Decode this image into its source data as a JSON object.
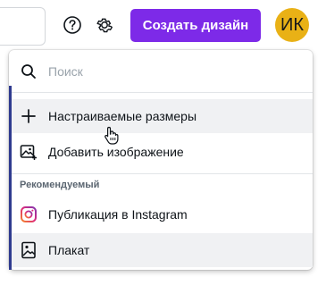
{
  "header": {
    "create_button_label": "Создать дизайн",
    "avatar_initials": "ИК",
    "help_icon": "question-circle-icon",
    "settings_icon": "gear-icon"
  },
  "dropdown": {
    "search_placeholder": "Поиск",
    "items": [
      {
        "label": "Настраиваемые размеры",
        "icon": "plus-icon"
      },
      {
        "label": "Добавить изображение",
        "icon": "image-add-icon"
      }
    ],
    "section_label": "Рекомендуемый",
    "recommended": [
      {
        "label": "Публикация в Instagram",
        "icon": "instagram-icon"
      },
      {
        "label": "Плакат",
        "icon": "poster-icon"
      }
    ]
  },
  "colors": {
    "accent": "#7d2ae8",
    "avatar_bg": "#e9b116",
    "instagram": "#e1306c"
  }
}
